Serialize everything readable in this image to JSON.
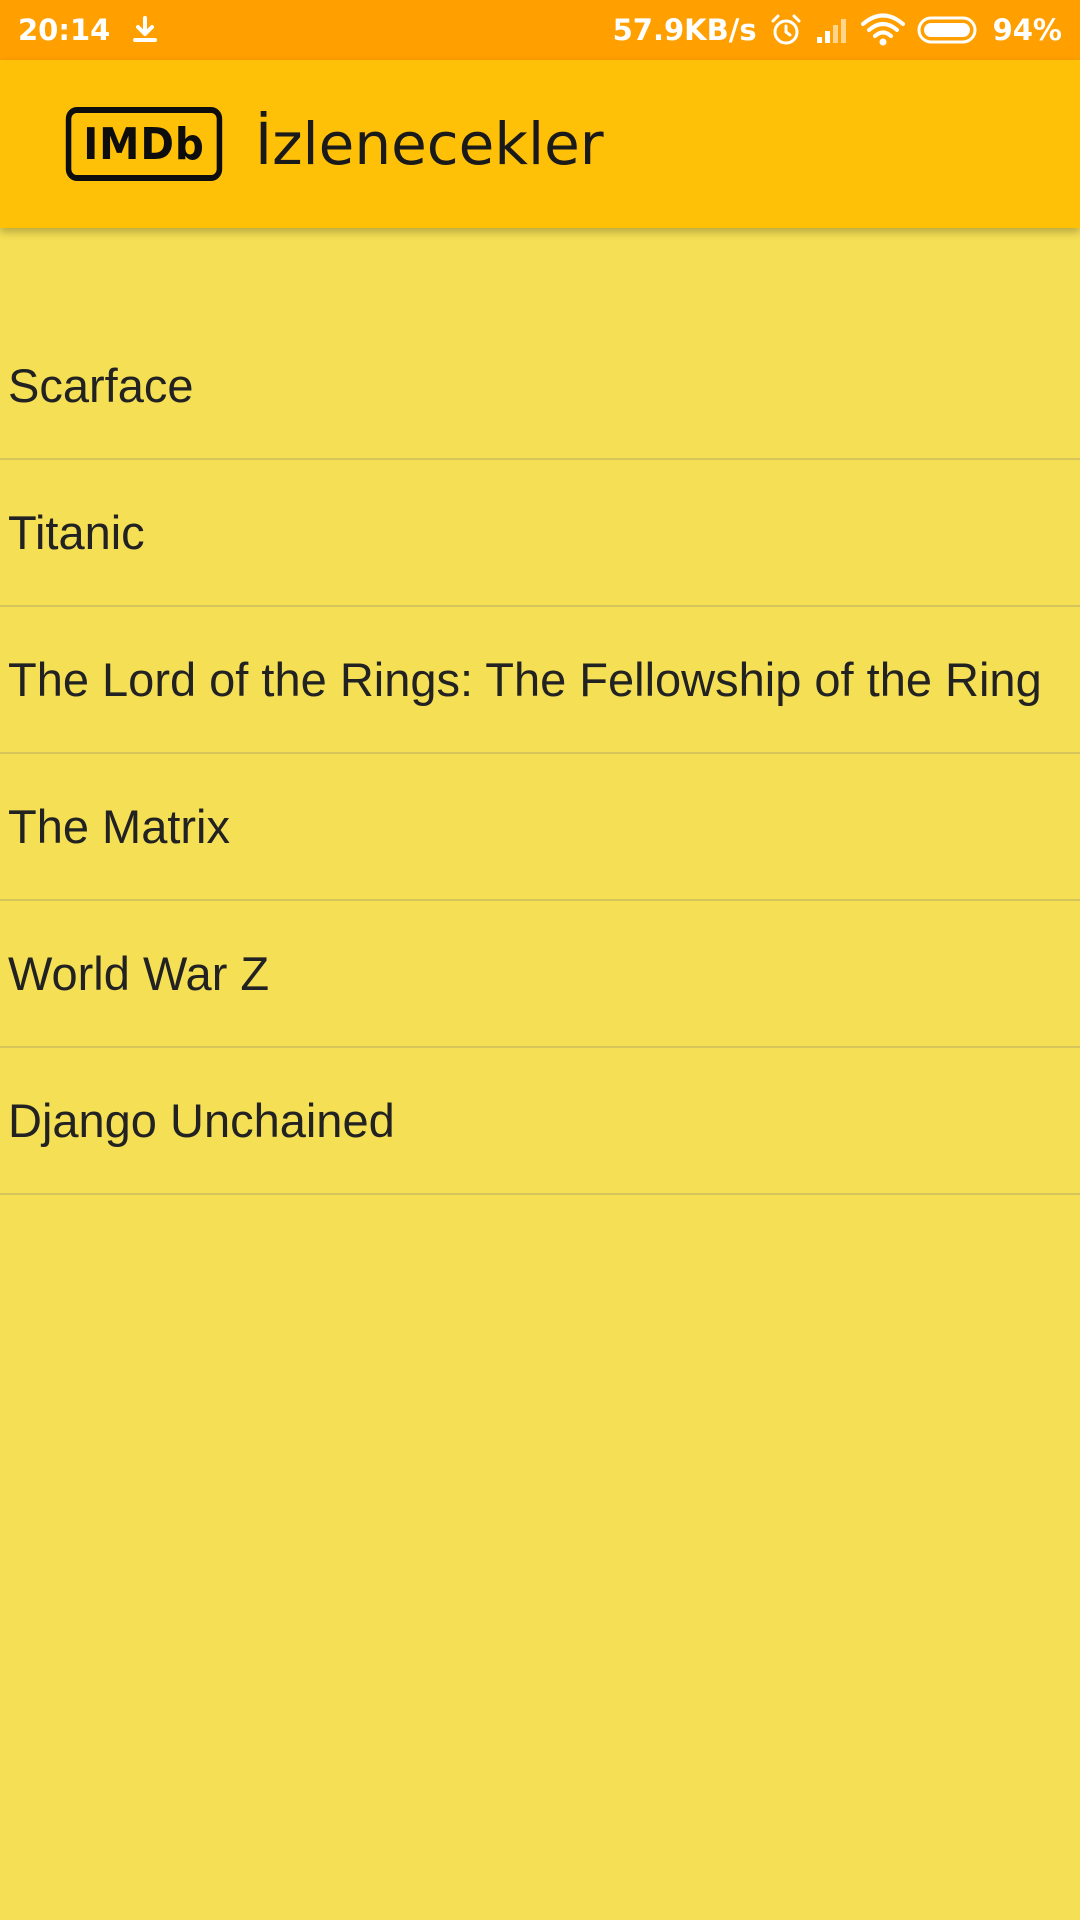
{
  "status_bar": {
    "time": "20:14",
    "speed": "57.9KB/s",
    "battery": "94%",
    "icons": [
      "download-icon",
      "alarm-icon",
      "signal-icon",
      "wifi-icon",
      "battery-icon"
    ]
  },
  "app_bar": {
    "logo_text": "IMDb",
    "title": "İzlenecekler"
  },
  "colors": {
    "status_bar": "#ff9f00",
    "app_bar": "#ffc107",
    "background": "#f4df55",
    "divider": "#d6c55a",
    "text": "#222222"
  },
  "movies": [
    "Scarface",
    "Titanic",
    "The Lord of the Rings: The Fellowship of the Ring",
    "The Matrix",
    "World War Z",
    "Django Unchained"
  ]
}
